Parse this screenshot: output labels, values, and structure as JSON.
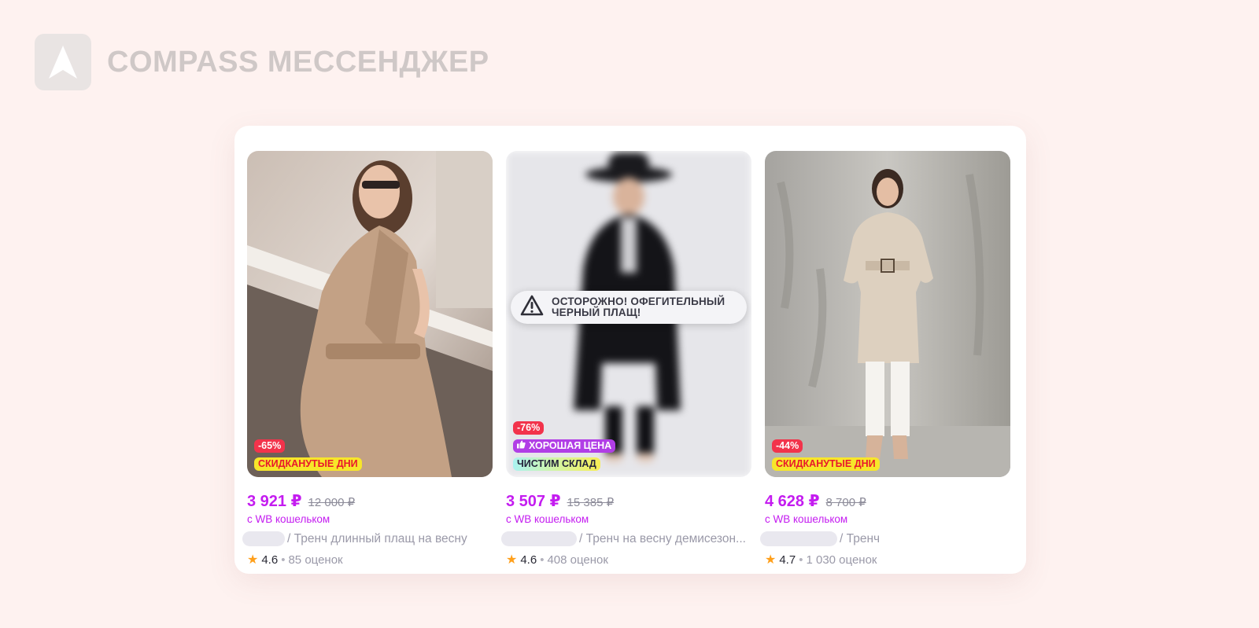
{
  "brand": {
    "title": "COMPASS МЕССЕНДЖЕР",
    "logo_icon": "compass-arrow-icon"
  },
  "products": [
    {
      "discount": "-65%",
      "promo": "СКИДКАНУТЫЕ ДНИ",
      "price": "3 921 ₽",
      "old_price": "12 000 ₽",
      "wallet_note": "с WB кошельком",
      "title": "/ Тренч длинный плащ на весну",
      "rating": "4.6",
      "reviews": "85 оценок"
    },
    {
      "warning": {
        "line1": "ОСТОРОЖНО! ОФЕГИТЕЛЬНЫЙ",
        "line2": "ЧЕРНЫЙ ПЛАЩ!",
        "icon": "warning-triangle-icon"
      },
      "discount": "-76%",
      "good_price": "ХОРОШАЯ ЦЕНА",
      "good_price_icon": "thumbs-up-icon",
      "promo": "ЧИСТИМ СКЛАД",
      "price": "3 507 ₽",
      "old_price": "15 385 ₽",
      "wallet_note": "с WB кошельком",
      "title": "/ Тренч на весну демисезон...",
      "rating": "4.6",
      "reviews": "408 оценок"
    },
    {
      "discount": "-44%",
      "promo": "СКИДКАНУТЫЕ ДНИ",
      "price": "4 628 ₽",
      "old_price": "8 700 ₽",
      "wallet_note": "с WB кошельком",
      "title": "/ Тренч",
      "rating": "4.7",
      "reviews": "1 030 оценок"
    }
  ],
  "colors": {
    "background": "#fef2f0",
    "price": "#c41cf0",
    "discount_badge": "#f2334b",
    "promo_badge": "#f7e62a",
    "good_price_badge": "#b13ee6",
    "star": "#ff9f1a"
  }
}
